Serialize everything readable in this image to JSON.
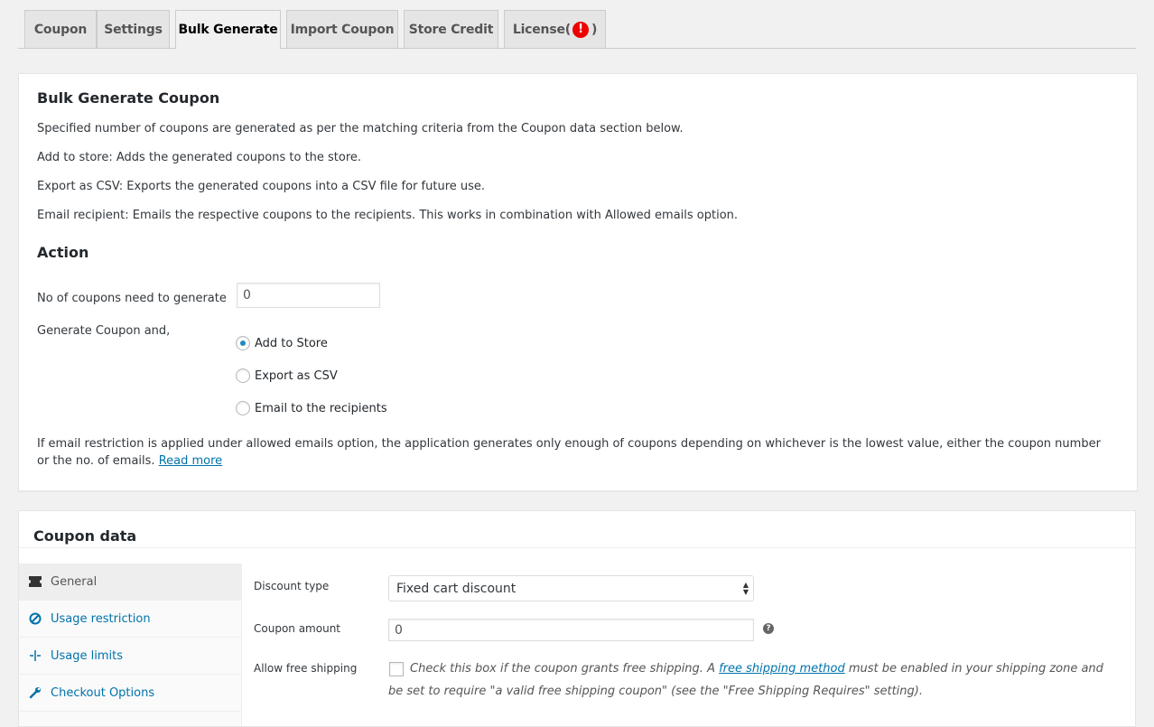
{
  "tabs": [
    {
      "label": "Coupon"
    },
    {
      "label": "Settings"
    },
    {
      "label": "Bulk Generate"
    },
    {
      "label": "Import Coupon"
    },
    {
      "label": "Store Credit"
    },
    {
      "label": "License(",
      "suffix": ")",
      "icon": "alert-icon",
      "icon_glyph": "!"
    }
  ],
  "active_tab": "Bulk Generate",
  "bulk": {
    "title": "Bulk Generate Coupon",
    "desc1": "Specified number of coupons are generated as per the matching criteria from the Coupon data section below.",
    "desc2": "Add to store: Adds the generated coupons to the store.",
    "desc3": "Export as CSV: Exports the generated coupons into a CSV file for future use.",
    "desc4": "Email recipient: Emails the respective coupons to the recipients. This works in combination with Allowed emails option.",
    "action_title": "Action",
    "count_label": "No of coupons need to generate",
    "count_value": "0",
    "generate_label": "Generate Coupon and,",
    "options": [
      {
        "label": "Add to Store",
        "selected": true
      },
      {
        "label": "Export as CSV",
        "selected": false
      },
      {
        "label": "Email to the recipients",
        "selected": false
      }
    ],
    "note": "If email restriction is applied under allowed emails option, the application generates only enough of coupons depending on whichever is the lowest value, either the coupon number or the no. of emails.",
    "read_more": "Read more"
  },
  "coupon_data": {
    "title": "Coupon data",
    "sidebar": [
      {
        "label": "General",
        "icon": "ticket-icon"
      },
      {
        "label": "Usage restriction",
        "icon": "ban-icon"
      },
      {
        "label": "Usage limits",
        "icon": "limits-icon"
      },
      {
        "label": "Checkout Options",
        "icon": "wrench-icon"
      }
    ],
    "discount_type_label": "Discount type",
    "discount_type_value": "Fixed cart discount",
    "coupon_amount_label": "Coupon amount",
    "coupon_amount_value": "0",
    "help_glyph": "?",
    "free_shipping_label": "Allow free shipping",
    "free_shipping_desc_pre": "Check this box if the coupon grants free shipping. A",
    "free_shipping_link": "free shipping method",
    "free_shipping_desc_post": "must be enabled in your shipping zone and be set to require \"a valid free shipping coupon\" (see the \"Free Shipping Requires\" setting)."
  },
  "colors": {
    "link": "#0073aa",
    "radio": "#1e8cbe",
    "alert": "#ee0000"
  }
}
